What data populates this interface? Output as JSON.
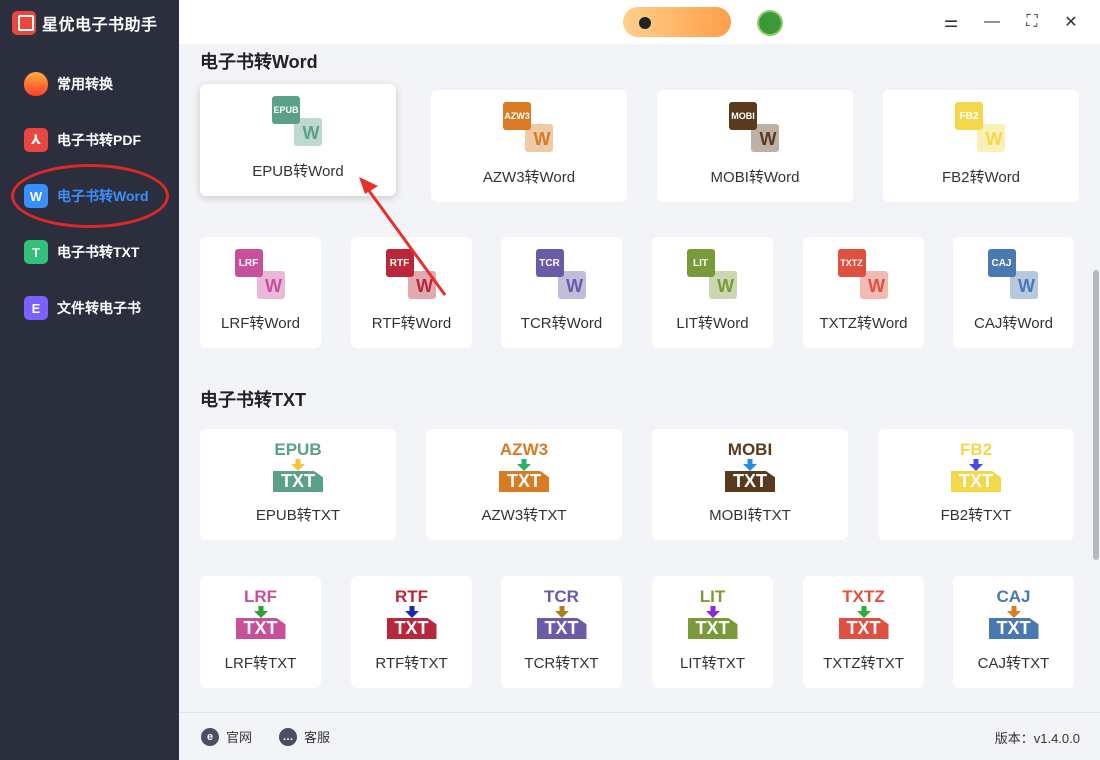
{
  "app": {
    "title": "星优电子书助手"
  },
  "sidebar": {
    "items": [
      {
        "label": "常用转换",
        "icon": "flame-icon",
        "glyph": "",
        "color": "#ff5a3c"
      },
      {
        "label": "电子书转PDF",
        "icon": "pdf-icon",
        "glyph": "⅄",
        "color": "#e8463e"
      },
      {
        "label": "电子书转Word",
        "icon": "word-icon",
        "glyph": "W",
        "color": "#3a8fff",
        "active": true
      },
      {
        "label": "电子书转TXT",
        "icon": "txt-icon",
        "glyph": "T",
        "color": "#33c07a"
      },
      {
        "label": "文件转电子书",
        "icon": "ebook-icon",
        "glyph": "E",
        "color": "#7b61ff"
      }
    ]
  },
  "window_controls": {
    "settings": "⚌",
    "minimize": "—",
    "maximize": "⛶",
    "close": "✕"
  },
  "sections": {
    "word_title": "电子书转Word",
    "txt_title": "电子书转TXT"
  },
  "word_cards": [
    {
      "format": "EPUB",
      "label": "EPUB转Word",
      "color": "#5aa08a"
    },
    {
      "format": "AZW3",
      "label": "AZW3转Word",
      "color": "#d87b22"
    },
    {
      "format": "MOBI",
      "label": "MOBI转Word",
      "color": "#5a3a1e"
    },
    {
      "format": "FB2",
      "label": "FB2转Word",
      "color": "#f2d84a"
    },
    {
      "format": "LRF",
      "label": "LRF转Word",
      "color": "#c8509a"
    },
    {
      "format": "RTF",
      "label": "RTF转Word",
      "color": "#b8283a"
    },
    {
      "format": "TCR",
      "label": "TCR转Word",
      "color": "#6a5aa8"
    },
    {
      "format": "LIT",
      "label": "LIT转Word",
      "color": "#7a9a3a"
    },
    {
      "format": "TXTZ",
      "label": "TXTZ转Word",
      "color": "#e05040"
    },
    {
      "format": "CAJ",
      "label": "CAJ转Word",
      "color": "#4a78b0"
    }
  ],
  "txt_cards": [
    {
      "format": "EPUB",
      "label": "EPUB转TXT",
      "color": "#5aa08a",
      "arrow": "#f2c53a"
    },
    {
      "format": "AZW3",
      "label": "AZW3转TXT",
      "color": "#d87b22",
      "arrow": "#2ab06a"
    },
    {
      "format": "MOBI",
      "label": "MOBI转TXT",
      "color": "#5a3a1e",
      "arrow": "#2a8ae8"
    },
    {
      "format": "FB2",
      "label": "FB2转TXT",
      "color": "#f2d84a",
      "arrow": "#4a4ae0"
    },
    {
      "format": "LRF",
      "label": "LRF转TXT",
      "color": "#c8509a",
      "arrow": "#2aa03a"
    },
    {
      "format": "RTF",
      "label": "RTF转TXT",
      "color": "#b8283a",
      "arrow": "#1a2aa8"
    },
    {
      "format": "TCR",
      "label": "TCR转TXT",
      "color": "#6a5aa8",
      "arrow": "#a8801a"
    },
    {
      "format": "LIT",
      "label": "LIT转TXT",
      "color": "#7a9a3a",
      "arrow": "#8a2ad8"
    },
    {
      "format": "TXTZ",
      "label": "TXTZ转TXT",
      "color": "#e05040",
      "arrow": "#2ab03a"
    },
    {
      "format": "CAJ",
      "label": "CAJ转TXT",
      "color": "#4a78b0",
      "arrow": "#e07a1a"
    }
  ],
  "footer": {
    "website": "官网",
    "service": "客服",
    "version": "版本：v1.4.0.0"
  },
  "selected_card": "EPUB转Word"
}
